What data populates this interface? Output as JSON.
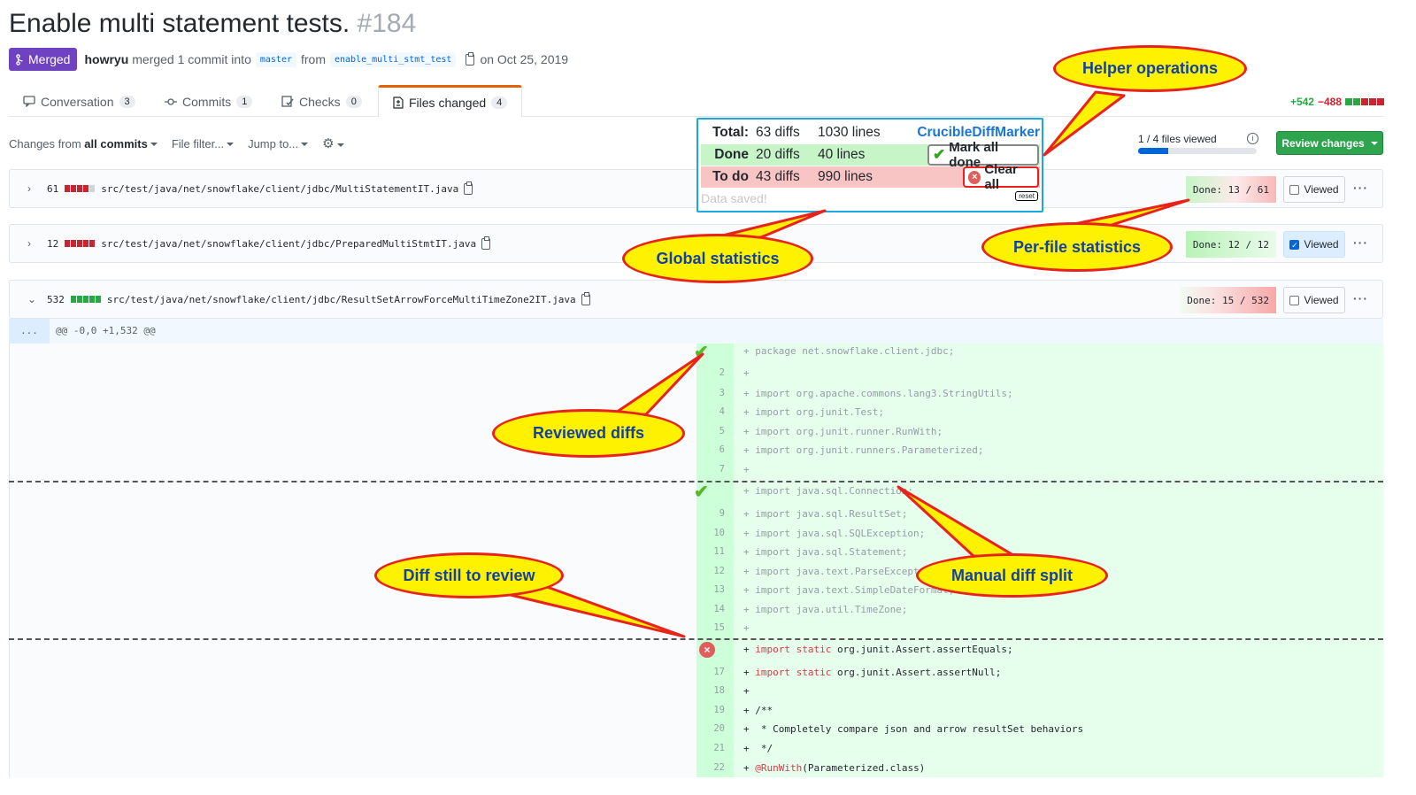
{
  "pr": {
    "title": "Enable multi statement tests.",
    "number": "#184",
    "state": "Merged",
    "author": "howryu",
    "merged_text": "merged 1 commit into",
    "base_branch": "master",
    "from_text": "from",
    "head_branch": "enable_multi_stmt_test",
    "date_text": "on Oct 25, 2019"
  },
  "tabs": [
    {
      "label": "Conversation",
      "count": "3",
      "icon": "comment-icon"
    },
    {
      "label": "Commits",
      "count": "1",
      "icon": "commit-icon"
    },
    {
      "label": "Checks",
      "count": "0",
      "icon": "checklist-icon"
    },
    {
      "label": "Files changed",
      "count": "4",
      "icon": "file-diff-icon",
      "active": true
    }
  ],
  "diffstat": {
    "additions": "+542",
    "deletions": "−488"
  },
  "toolbar": {
    "changes_prefix": "Changes from",
    "changes_value": "all commits",
    "file_filter": "File filter...",
    "jump_to": "Jump to...",
    "files_viewed": "1 / 4 files viewed",
    "files_viewed_progress": 0.25,
    "review_button": "Review changes"
  },
  "global_stats": {
    "total_label": "Total:",
    "total_diffs": "63 diffs",
    "total_lines": "1030 lines",
    "brand": "CrucibleDiffMarker",
    "done_label": "Done",
    "done_diffs": "20 diffs",
    "done_lines": "40 lines",
    "mark_all_done": "Mark all done",
    "todo_label": "To do",
    "todo_diffs": "43 diffs",
    "todo_lines": "990 lines",
    "clear_all": "Clear all",
    "saved_text": "Data saved!",
    "reset_label": "reset"
  },
  "files": [
    {
      "count": "61",
      "path": "src/test/java/net/snowflake/client/jdbc/MultiStatementIT.java",
      "done": "Done: 13 / 61",
      "viewed_label": "Viewed",
      "viewed": false,
      "expanded": false
    },
    {
      "count": "12",
      "path": "src/test/java/net/snowflake/client/jdbc/PreparedMultiStmtIT.java",
      "done": "Done: 12 / 12",
      "viewed_label": "Viewed",
      "viewed": true,
      "expanded": false
    },
    {
      "count": "532",
      "path": "src/test/java/net/snowflake/client/jdbc/ResultSetArrowForceMultiTimeZone2IT.java",
      "done": "Done: 15 / 532",
      "viewed_label": "Viewed",
      "viewed": false,
      "expanded": true
    }
  ],
  "hunk": {
    "dots": "...",
    "header": "@@ -0,0 +1,532 @@"
  },
  "diff_lines": [
    {
      "ln": "",
      "code": "+ package net.snowflake.client.jdbc;"
    },
    {
      "ln": "2",
      "code": "+"
    },
    {
      "ln": "3",
      "code": "+ import org.apache.commons.lang3.StringUtils;"
    },
    {
      "ln": "4",
      "code": "+ import org.junit.Test;"
    },
    {
      "ln": "5",
      "code": "+ import org.junit.runner.RunWith;"
    },
    {
      "ln": "6",
      "code": "+ import org.junit.runners.Parameterized;"
    },
    {
      "ln": "7",
      "code": "+"
    },
    {
      "ln": "",
      "code": "+ import java.sql.Connection;"
    },
    {
      "ln": "9",
      "code": "+ import java.sql.ResultSet;"
    },
    {
      "ln": "10",
      "code": "+ import java.sql.SQLException;"
    },
    {
      "ln": "11",
      "code": "+ import java.sql.Statement;"
    },
    {
      "ln": "12",
      "code": "+ import java.text.ParseException;"
    },
    {
      "ln": "13",
      "code": "+ import java.text.SimpleDateFormat;"
    },
    {
      "ln": "14",
      "code": "+ import java.util.TimeZone;"
    },
    {
      "ln": "15",
      "code": "+"
    },
    {
      "ln": "",
      "code_pre": "+ ",
      "kw": "import static",
      "code_post": " org.junit.Assert.assertEquals;"
    },
    {
      "ln": "17",
      "code_pre": "+ ",
      "kw": "import static",
      "code_post": " org.junit.Assert.assertNull;"
    },
    {
      "ln": "18",
      "code": "+"
    },
    {
      "ln": "19",
      "code": "+ /**"
    },
    {
      "ln": "20",
      "code": "+  * Completely compare json and arrow resultSet behaviors"
    },
    {
      "ln": "21",
      "code": "+  */"
    },
    {
      "ln": "22",
      "code_pre": "+ ",
      "kw": "@RunWith",
      "code_post": "(Parameterized.class)"
    }
  ],
  "callouts": {
    "helper": "Helper operations",
    "global": "Global statistics",
    "perfile": "Per-file statistics",
    "reviewed": "Reviewed diffs",
    "still": "Diff still to review",
    "split": "Manual diff split"
  },
  "colors": {
    "merged": "#6f42c1",
    "add": "#28a745",
    "del": "#cb2431",
    "callout_fill": "#fff200",
    "callout_border": "#e8231c",
    "callout_text": "#1241a3",
    "done_green": "#c7f5c7",
    "todo_red": "#f9c4c4"
  }
}
